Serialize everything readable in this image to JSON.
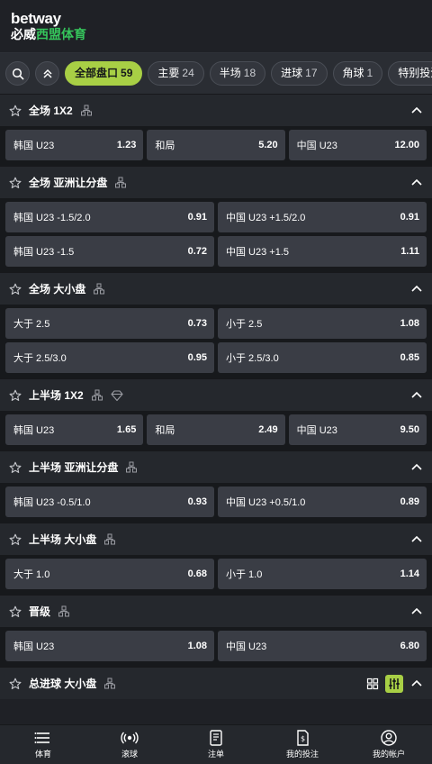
{
  "brand": {
    "name": "betway",
    "cn_white": "必威",
    "cn_green": "西盟体育"
  },
  "filters": [
    {
      "label": "全部盘口",
      "count": "59",
      "active": true
    },
    {
      "label": "主要",
      "count": "24",
      "active": false
    },
    {
      "label": "半场",
      "count": "18",
      "active": false
    },
    {
      "label": "进球",
      "count": "17",
      "active": false
    },
    {
      "label": "角球",
      "count": "1",
      "active": false
    },
    {
      "label": "特别投注",
      "count": "",
      "active": false
    }
  ],
  "markets": [
    {
      "title": "全场 1X2",
      "rows": [
        [
          {
            "label": "韩国 U23",
            "odds": "1.23"
          },
          {
            "label": "和局",
            "odds": "5.20"
          },
          {
            "label": "中国 U23",
            "odds": "12.00"
          }
        ]
      ]
    },
    {
      "title": "全场 亚洲让分盘",
      "rows": [
        [
          {
            "label": "韩国 U23  -1.5/2.0",
            "odds": "0.91"
          },
          {
            "label": "中国 U23  +1.5/2.0",
            "odds": "0.91"
          }
        ],
        [
          {
            "label": "韩国 U23  -1.5",
            "odds": "0.72"
          },
          {
            "label": "中国 U23  +1.5",
            "odds": "1.11"
          }
        ]
      ]
    },
    {
      "title": "全场 大小盘",
      "rows": [
        [
          {
            "label": "大于 2.5",
            "odds": "0.73"
          },
          {
            "label": "小于 2.5",
            "odds": "1.08"
          }
        ],
        [
          {
            "label": "大于 2.5/3.0",
            "odds": "0.95"
          },
          {
            "label": "小于 2.5/3.0",
            "odds": "0.85"
          }
        ]
      ]
    },
    {
      "title": "上半场 1X2",
      "diamond": true,
      "rows": [
        [
          {
            "label": "韩国 U23",
            "odds": "1.65"
          },
          {
            "label": "和局",
            "odds": "2.49"
          },
          {
            "label": "中国 U23",
            "odds": "9.50"
          }
        ]
      ]
    },
    {
      "title": "上半场 亚洲让分盘",
      "rows": [
        [
          {
            "label": "韩国 U23  -0.5/1.0",
            "odds": "0.93"
          },
          {
            "label": "中国 U23  +0.5/1.0",
            "odds": "0.89"
          }
        ]
      ]
    },
    {
      "title": "上半场 大小盘",
      "rows": [
        [
          {
            "label": "大于 1.0",
            "odds": "0.68"
          },
          {
            "label": "小于 1.0",
            "odds": "1.14"
          }
        ]
      ]
    },
    {
      "title": "晋级",
      "rows": [
        [
          {
            "label": "韩国 U23",
            "odds": "1.08"
          },
          {
            "label": "中国 U23",
            "odds": "6.80"
          }
        ]
      ]
    },
    {
      "title": "总进球 大小盘",
      "controls": true,
      "rows": []
    }
  ],
  "bottom_nav": [
    {
      "label": "体育",
      "icon": "sports-list-icon"
    },
    {
      "label": "滚球",
      "icon": "live-broadcast-icon"
    },
    {
      "label": "注单",
      "icon": "betslip-icon"
    },
    {
      "label": "我的投注",
      "icon": "my-bets-icon"
    },
    {
      "label": "我的帐户",
      "icon": "account-icon"
    }
  ],
  "colors": {
    "accent": "#a8cf45",
    "brand_green": "#35c45b",
    "background": "#1f2126",
    "button": "#3a3d45"
  }
}
